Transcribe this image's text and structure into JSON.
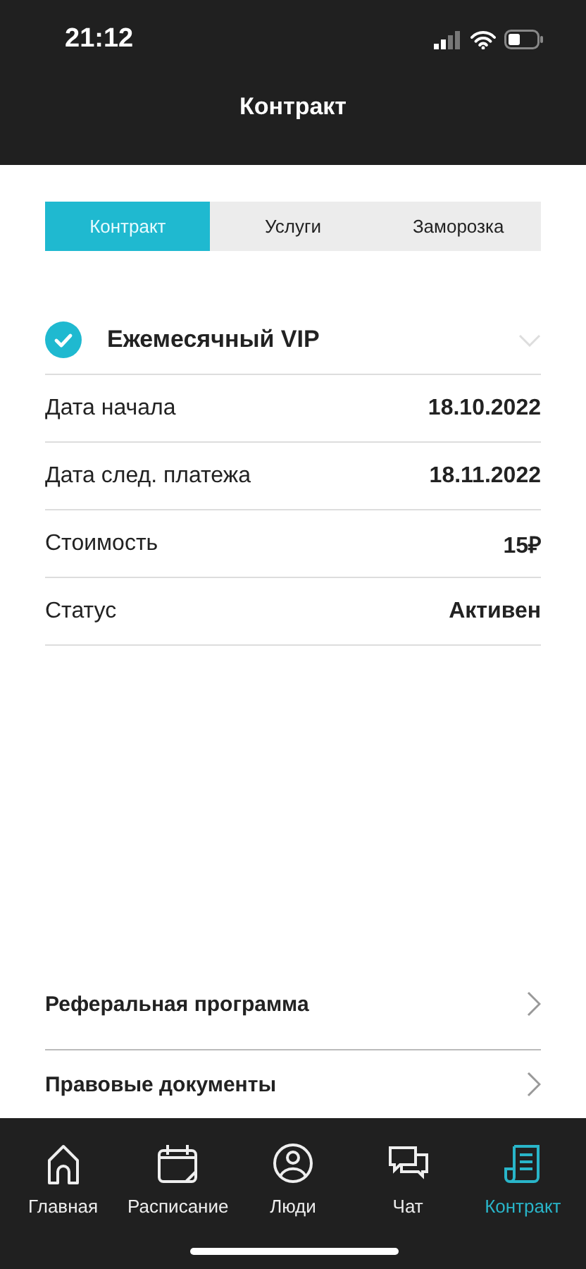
{
  "status_bar": {
    "time": "21:12"
  },
  "header": {
    "title": "Контракт"
  },
  "tabs": [
    {
      "label": "Контракт",
      "selected": true
    },
    {
      "label": "Услуги",
      "selected": false
    },
    {
      "label": "Заморозка",
      "selected": false
    }
  ],
  "plan": {
    "title": "Ежемесячный VIP",
    "checked": true,
    "expanded": false
  },
  "details": [
    {
      "label": "Дата начала",
      "value": "18.10.2022"
    },
    {
      "label": "Дата след. платежа",
      "value": "18.11.2022"
    },
    {
      "label": "Стоимость",
      "value": "15₽"
    },
    {
      "label": "Статус",
      "value": "Активен"
    }
  ],
  "links": [
    {
      "label": "Реферальная программа"
    },
    {
      "label": "Правовые документы"
    }
  ],
  "tab_bar": [
    {
      "kind": "home",
      "label": "Главная",
      "selected": false
    },
    {
      "kind": "calendar",
      "label": "Расписание",
      "selected": false
    },
    {
      "kind": "person",
      "label": "Люди",
      "selected": false
    },
    {
      "kind": "chat",
      "label": "Чат",
      "selected": false
    },
    {
      "kind": "contract",
      "label": "Контракт",
      "selected": true
    }
  ]
}
